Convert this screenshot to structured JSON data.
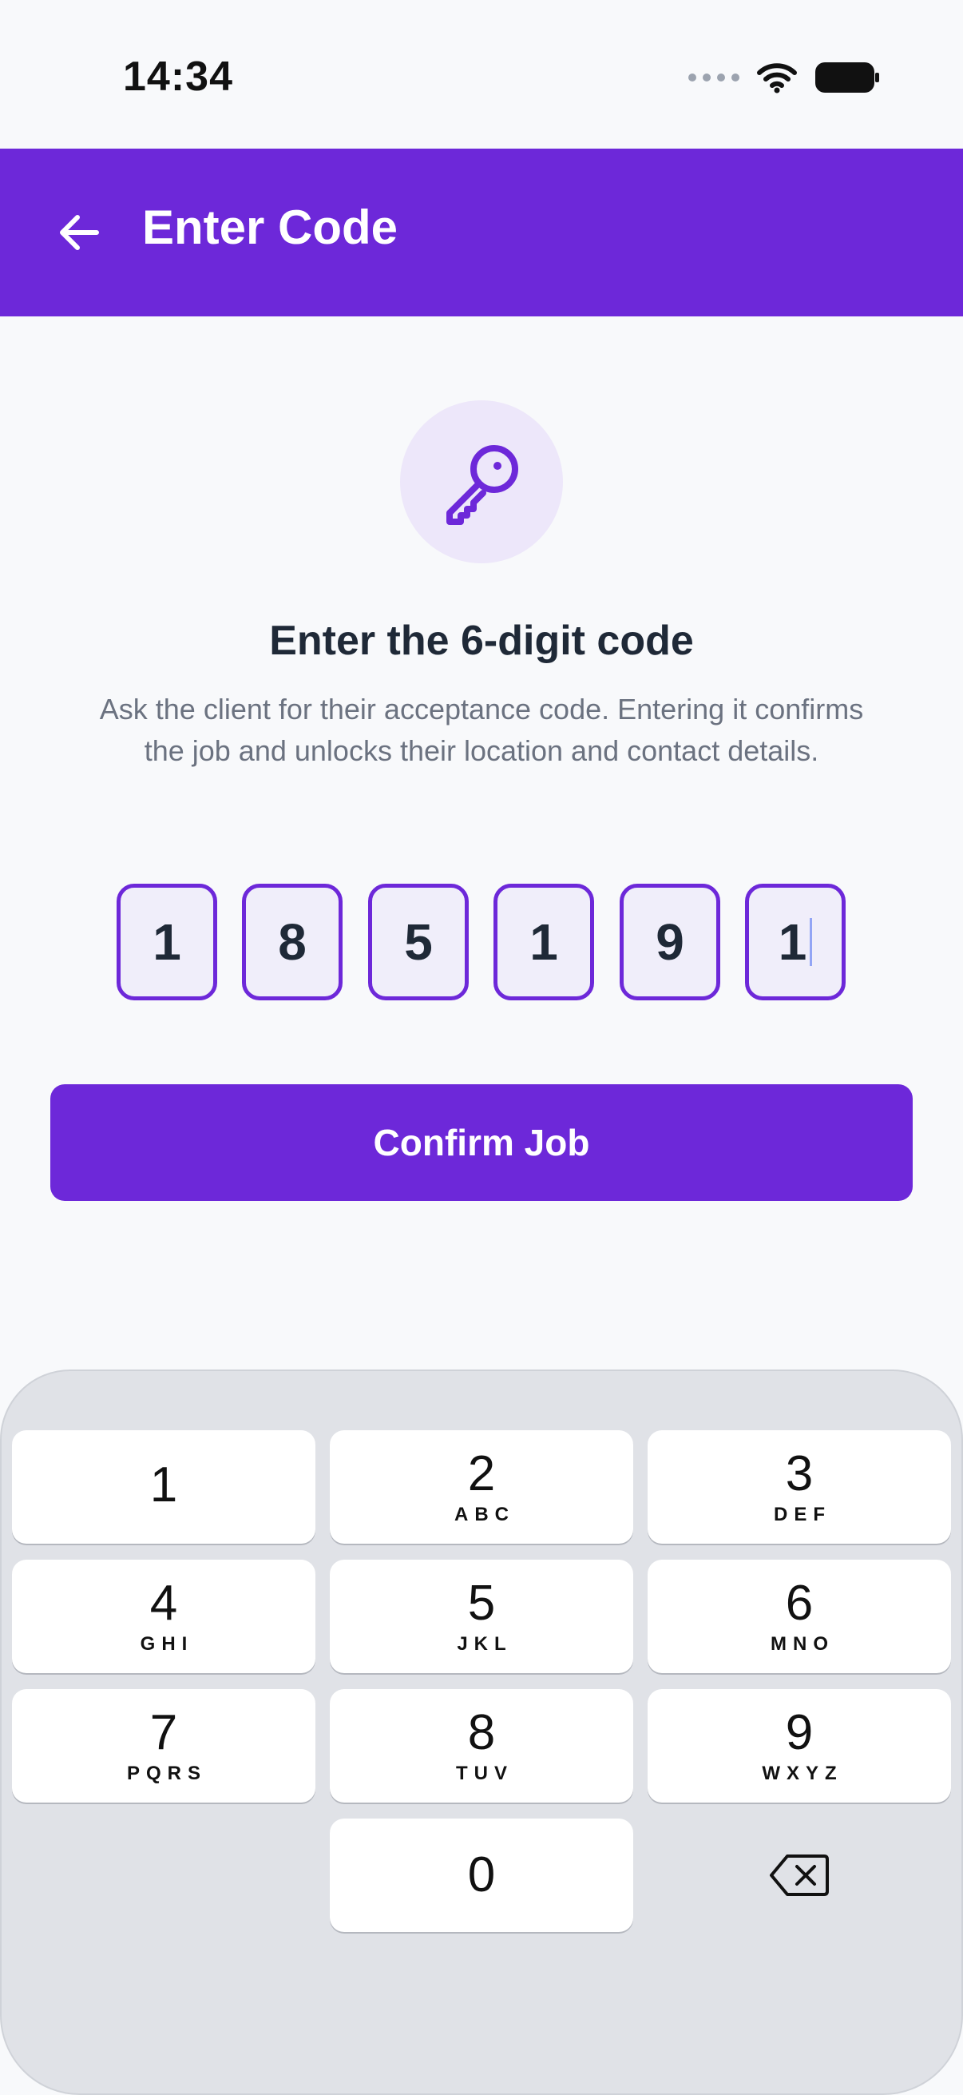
{
  "status_bar": {
    "time": "14:34"
  },
  "app_bar": {
    "title": "Enter Code"
  },
  "content": {
    "heading": "Enter the 6-digit code",
    "description": "Ask the client for their acceptance code. Entering it confirms the job and unlocks their location and contact details.",
    "code_digits": [
      "1",
      "8",
      "5",
      "1",
      "9",
      "1"
    ],
    "confirm_label": "Confirm Job"
  },
  "keypad": [
    {
      "num": "1",
      "letters": ""
    },
    {
      "num": "2",
      "letters": "ABC"
    },
    {
      "num": "3",
      "letters": "DEF"
    },
    {
      "num": "4",
      "letters": "GHI"
    },
    {
      "num": "5",
      "letters": "JKL"
    },
    {
      "num": "6",
      "letters": "MNO"
    },
    {
      "num": "7",
      "letters": "PQRS"
    },
    {
      "num": "8",
      "letters": "TUV"
    },
    {
      "num": "9",
      "letters": "WXYZ"
    },
    {
      "num": "0",
      "letters": ""
    }
  ],
  "colors": {
    "primary": "#6d28d9",
    "icon_bg": "#ede7fa",
    "code_box_bg": "#f0eefa",
    "keyboard_bg": "#e0e2e7"
  },
  "icons": {
    "back": "arrow-left-icon",
    "key": "key-icon",
    "delete": "backspace-icon",
    "wifi": "wifi-icon",
    "battery": "battery-icon"
  }
}
